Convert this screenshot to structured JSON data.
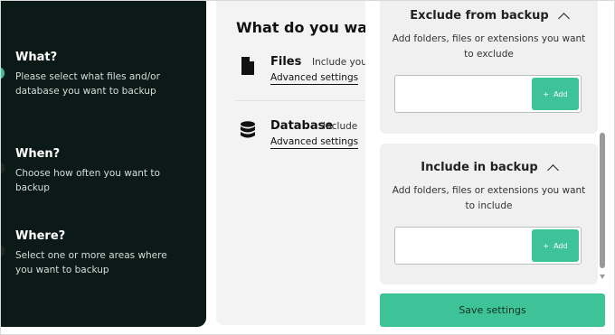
{
  "steps": {
    "what": {
      "title": "What?",
      "desc": "Please select what files and/or database you want to backup"
    },
    "when": {
      "title": "When?",
      "desc": "Choose how often you want to backup"
    },
    "where": {
      "title": "Where?",
      "desc": "Select one or more areas where you want to backup"
    }
  },
  "middle": {
    "title": "What do you want",
    "files": {
      "name": "Files",
      "desc": "Include your V",
      "advanced": "Advanced settings",
      "icon": "file-icon"
    },
    "database": {
      "name": "Database",
      "desc": "Include",
      "advanced": "Advanced settings",
      "icon": "database-icon"
    }
  },
  "exclude": {
    "title": "Exclude from backup",
    "desc": "Add folders, files or extensions you want to exclude",
    "input_value": "",
    "add_label": "Add"
  },
  "include": {
    "title": "Include in backup",
    "desc": "Add folders, files or extensions you want to include",
    "input_value": "",
    "add_label": "Add"
  },
  "save_label": "Save settings",
  "colors": {
    "accent": "#3dc397",
    "sidebar": "#0b1a17"
  }
}
